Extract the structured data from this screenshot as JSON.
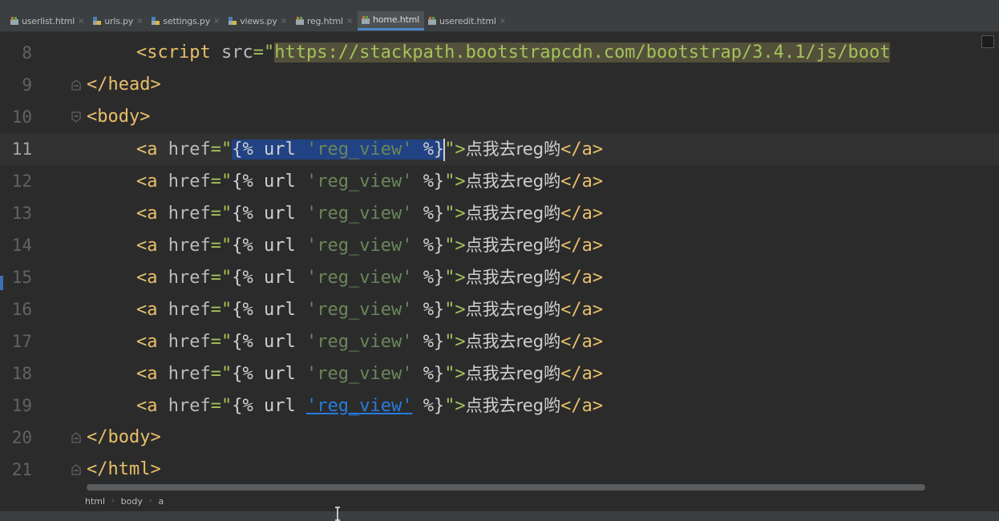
{
  "tabs": [
    {
      "label": "userlist.html",
      "type": "html",
      "active": false
    },
    {
      "label": "urls.py",
      "type": "py",
      "active": false
    },
    {
      "label": "settings.py",
      "type": "py",
      "active": false
    },
    {
      "label": "views.py",
      "type": "py",
      "active": false
    },
    {
      "label": "reg.html",
      "type": "html",
      "active": false
    },
    {
      "label": "home.html",
      "type": "html",
      "active": true
    },
    {
      "label": "useredit.html",
      "type": "html",
      "active": false
    }
  ],
  "editor": {
    "line_numbers": [
      "8",
      "9",
      "10",
      "11",
      "12",
      "13",
      "14",
      "15",
      "16",
      "17",
      "18",
      "19",
      "20",
      "21"
    ],
    "line8": {
      "tag_open": "<script ",
      "attr": "src",
      "eq": "=\"",
      "url": "https://stackpath.bootstrapcdn.com/bootstrap/3.4.1/js/boot"
    },
    "head_close": "</head>",
    "body_open": "<body>",
    "body_close": "</body>",
    "html_close": "</html>",
    "anchor": {
      "tag_open": "<a ",
      "attr": "href",
      "eq": "=\"",
      "tmpl_open": "{%",
      "url_kw": "url",
      "view_name": "'reg_view'",
      "tmpl_close": "%}",
      "end_quote": "\">",
      "text": "点我去reg哟",
      "tag_close": "</a>"
    }
  },
  "breadcrumb": [
    "html",
    "body",
    "a"
  ],
  "colors": {
    "background": "#2b2b2b",
    "tag": "#e8bf6a",
    "string": "#a5c25c",
    "template_string": "#6a8759",
    "selection": "#214283",
    "active_tab_underline": "#4a88c7"
  }
}
